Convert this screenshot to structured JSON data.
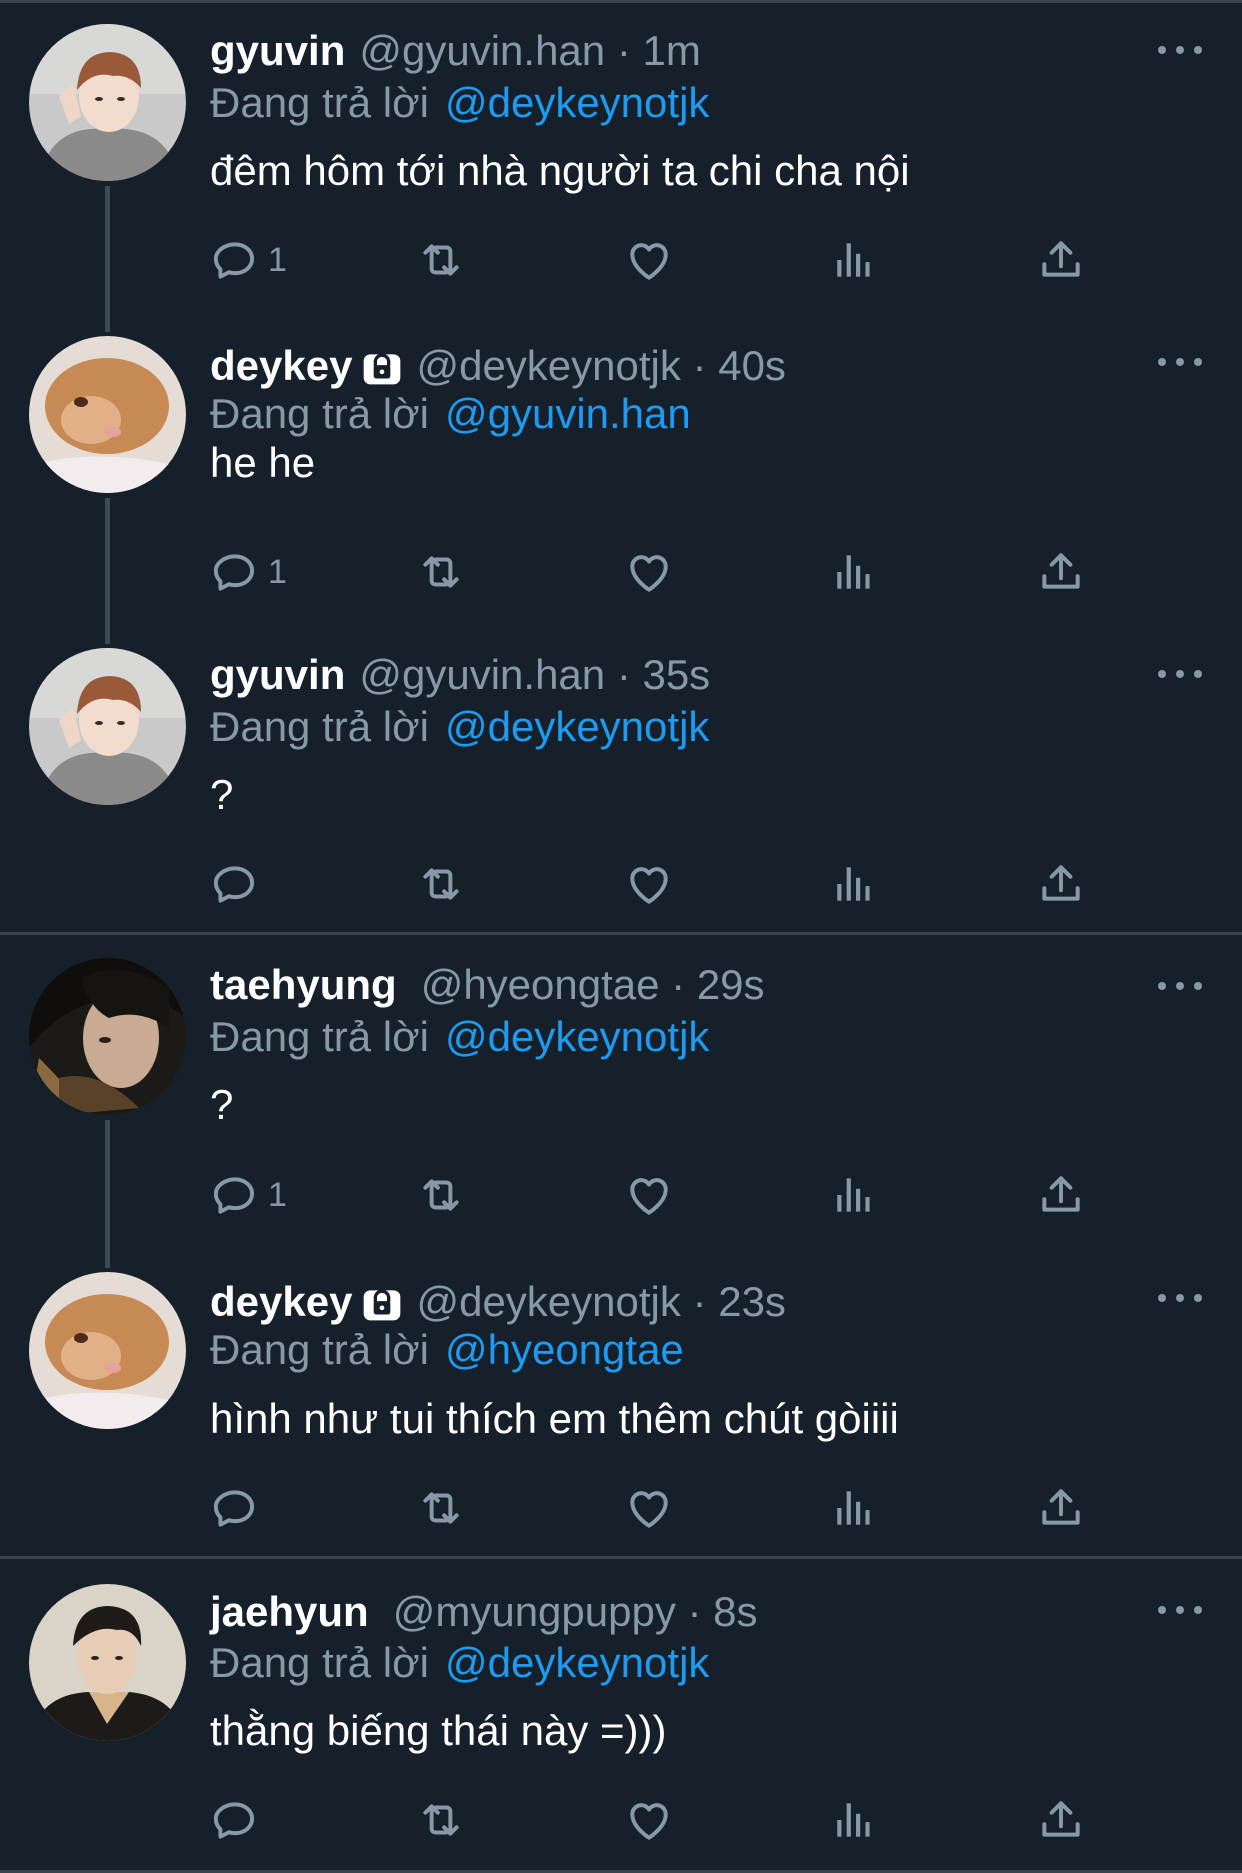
{
  "reply_prefix": "Đang trả lời",
  "colors": {
    "background": "#15202b",
    "muted": "#8899a6",
    "link": "#1d9bf0",
    "divider": "#38444d"
  },
  "tweets": [
    {
      "name": "gyuvin",
      "handle": "@gyuvin.han · 1m",
      "locked": false,
      "reply_to": "@deykeynotjk",
      "text": "đêm hôm tới nhà người ta chi cha nội",
      "reply_count": "1",
      "avatar_icon": "avatar-photo"
    },
    {
      "name": "deykey",
      "handle": "@deykeynotjk · 40s",
      "locked": true,
      "reply_to": "@gyuvin.han",
      "text": "he he",
      "reply_count": "1",
      "avatar_icon": "avatar-photo"
    },
    {
      "name": "gyuvin",
      "handle": "@gyuvin.han · 35s",
      "locked": false,
      "reply_to": "@deykeynotjk",
      "text": "?",
      "reply_count": "",
      "avatar_icon": "avatar-photo"
    },
    {
      "name": "taehyung",
      "handle": "@hyeongtae · 29s",
      "locked": false,
      "reply_to": "@deykeynotjk",
      "text": "?",
      "reply_count": "1",
      "avatar_icon": "avatar-photo"
    },
    {
      "name": "deykey",
      "handle": "@deykeynotjk · 23s",
      "locked": true,
      "reply_to": "@hyeongtae",
      "text": "hình như tui thích em thêm chút gòiiii",
      "reply_count": "",
      "avatar_icon": "avatar-photo"
    },
    {
      "name": "jaehyun",
      "handle": "@myungpuppy · 8s",
      "locked": false,
      "reply_to": "@deykeynotjk",
      "text": "thằng biếng thái này =)))",
      "reply_count": "",
      "avatar_icon": "avatar-photo"
    }
  ]
}
